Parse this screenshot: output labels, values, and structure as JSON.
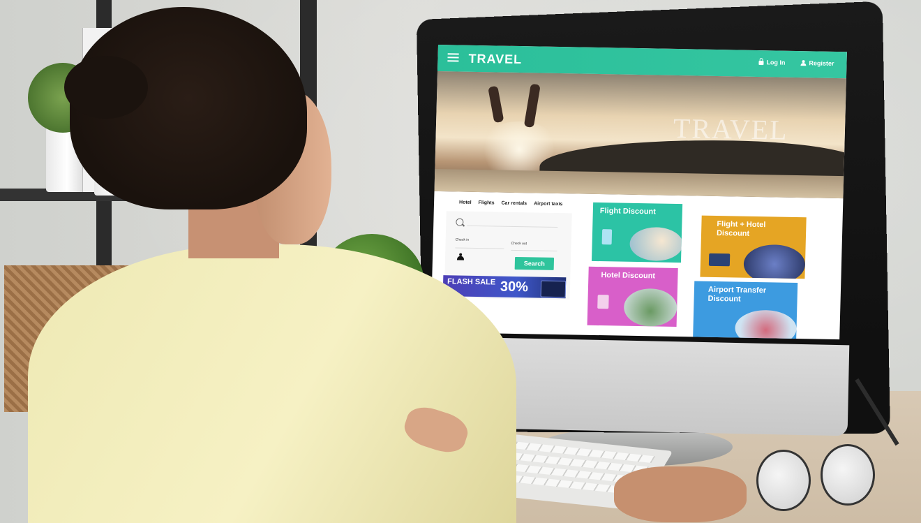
{
  "site": {
    "logo": "TRAVEL",
    "nav": {
      "login": "Log In",
      "register": "Register"
    },
    "hero_text": "TRAVEL",
    "search_tabs": [
      "Hotel",
      "Flights",
      "Car rentals",
      "Airport taxis"
    ],
    "search": {
      "check_in_label": "Check in",
      "check_out_label": "Check out",
      "button_label": "Search"
    },
    "flash_sale": {
      "label": "FLASH SALE",
      "percent": "30%"
    },
    "cards": [
      {
        "title": "Flight Discount",
        "color": "#2cc3a5"
      },
      {
        "title": "Flight + Hotel Discount",
        "color": "#e5a524"
      },
      {
        "title": "Hotel Discount",
        "color": "#d85fc9"
      },
      {
        "title": "Airport Transfer Discount",
        "color": "#3d9be0"
      }
    ]
  },
  "colors": {
    "brand": "#2bbf9a",
    "shirt": "#f1ecbd",
    "wall": "#d6d7d3"
  }
}
